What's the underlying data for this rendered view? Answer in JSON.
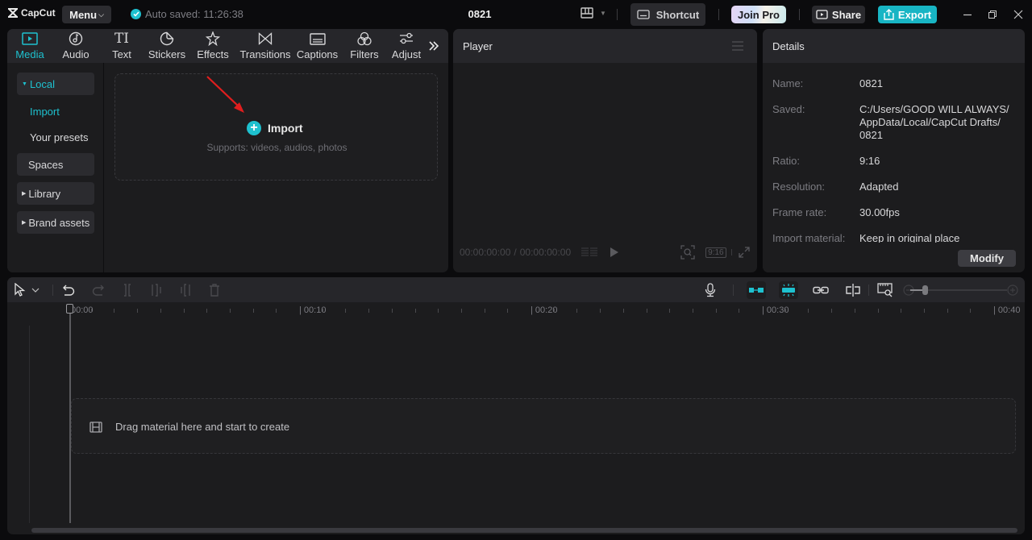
{
  "app": {
    "logo_text": "CapCut",
    "menu_label": "Menu",
    "autosave_text": "Auto saved: 11:26:38",
    "project_title": "0821",
    "shortcut_label": "Shortcut",
    "join_pro_label": "Join Pro",
    "share_label": "Share",
    "export_label": "Export"
  },
  "colors": {
    "accent": "#1ec1cf",
    "export_bg": "#18b5c4",
    "panel_bg": "#1c1c1e",
    "header_bg": "#26262a",
    "annotation_arrow": "#e01e1e"
  },
  "media_tabs": [
    {
      "label": "Media",
      "icon": "media-icon",
      "active": true
    },
    {
      "label": "Audio",
      "icon": "audio-icon",
      "active": false
    },
    {
      "label": "Text",
      "icon": "text-icon",
      "active": false
    },
    {
      "label": "Stickers",
      "icon": "stickers-icon",
      "active": false
    },
    {
      "label": "Effects",
      "icon": "effects-icon",
      "active": false
    },
    {
      "label": "Transitions",
      "icon": "transitions-icon",
      "active": false
    },
    {
      "label": "Captions",
      "icon": "captions-icon",
      "active": false
    },
    {
      "label": "Filters",
      "icon": "filters-icon",
      "active": false
    },
    {
      "label": "Adjust",
      "icon": "adjust-icon",
      "active": false
    }
  ],
  "sidebar": {
    "local": "Local",
    "import": "Import",
    "your_presets": "Your presets",
    "spaces": "Spaces",
    "library": "Library",
    "brand_assets": "Brand assets"
  },
  "import_zone": {
    "button_label": "Import",
    "hint": "Supports: videos, audios, photos"
  },
  "player": {
    "title": "Player",
    "current_time": "00:00:00:00",
    "total_time": "00:00:00:00",
    "ratio_badge": "9:16"
  },
  "details": {
    "title": "Details",
    "rows": [
      {
        "key": "Name:",
        "value": "0821"
      },
      {
        "key": "Saved:",
        "value": "C:/Users/GOOD WILL ALWAYS/ AppData/Local/CapCut Drafts/ 0821"
      },
      {
        "key": "Ratio:",
        "value": "9:16"
      },
      {
        "key": "Resolution:",
        "value": "Adapted"
      },
      {
        "key": "Frame rate:",
        "value": "30.00fps"
      },
      {
        "key": "Import material:",
        "value": "Keep in original place"
      }
    ],
    "modify_label": "Modify"
  },
  "timeline": {
    "ruler_labels": [
      "00:00",
      "00:10",
      "00:20",
      "00:30",
      "00:40"
    ],
    "drop_text": "Drag material here and start to create",
    "zoom_level": 0.15
  }
}
